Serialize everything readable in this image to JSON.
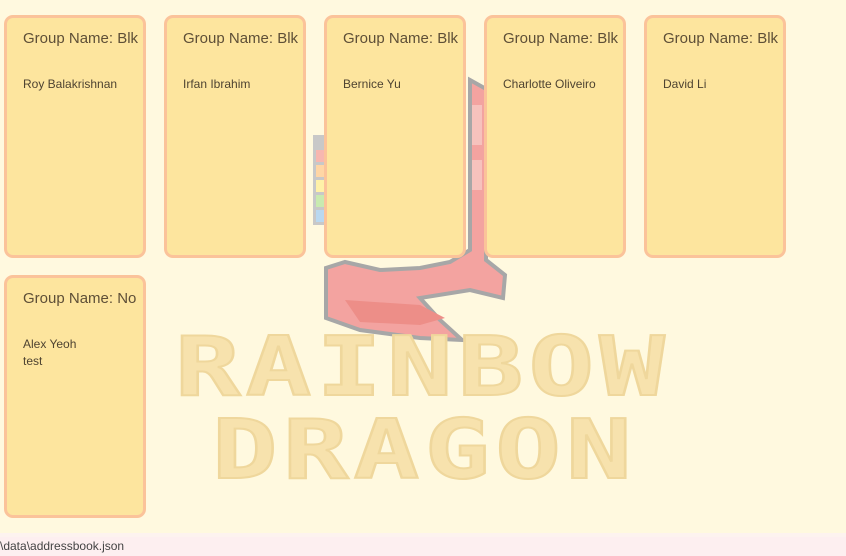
{
  "watermark": {
    "line1": "RAINBOW",
    "line2": "DRAGON"
  },
  "groups": [
    {
      "title": "Group Name: Blk",
      "members": [
        "Roy Balakrishnan"
      ]
    },
    {
      "title": "Group Name: Blk",
      "members": [
        "Irfan Ibrahim"
      ]
    },
    {
      "title": "Group Name: Blk",
      "members": [
        "Bernice Yu"
      ]
    },
    {
      "title": "Group Name: Blk",
      "members": [
        "Charlotte Oliveiro"
      ]
    },
    {
      "title": "Group Name: Blk",
      "members": [
        "David Li"
      ]
    },
    {
      "title": "Group Name: No",
      "members": [
        "Alex Yeoh",
        "test"
      ]
    }
  ],
  "status": {
    "path": "\\data\\addressbook.json"
  },
  "colors": {
    "panel_bg": "#fff9df",
    "card_bg": "#fde59e",
    "card_border": "#fbc39a",
    "status_bg": "#fdeff0"
  }
}
